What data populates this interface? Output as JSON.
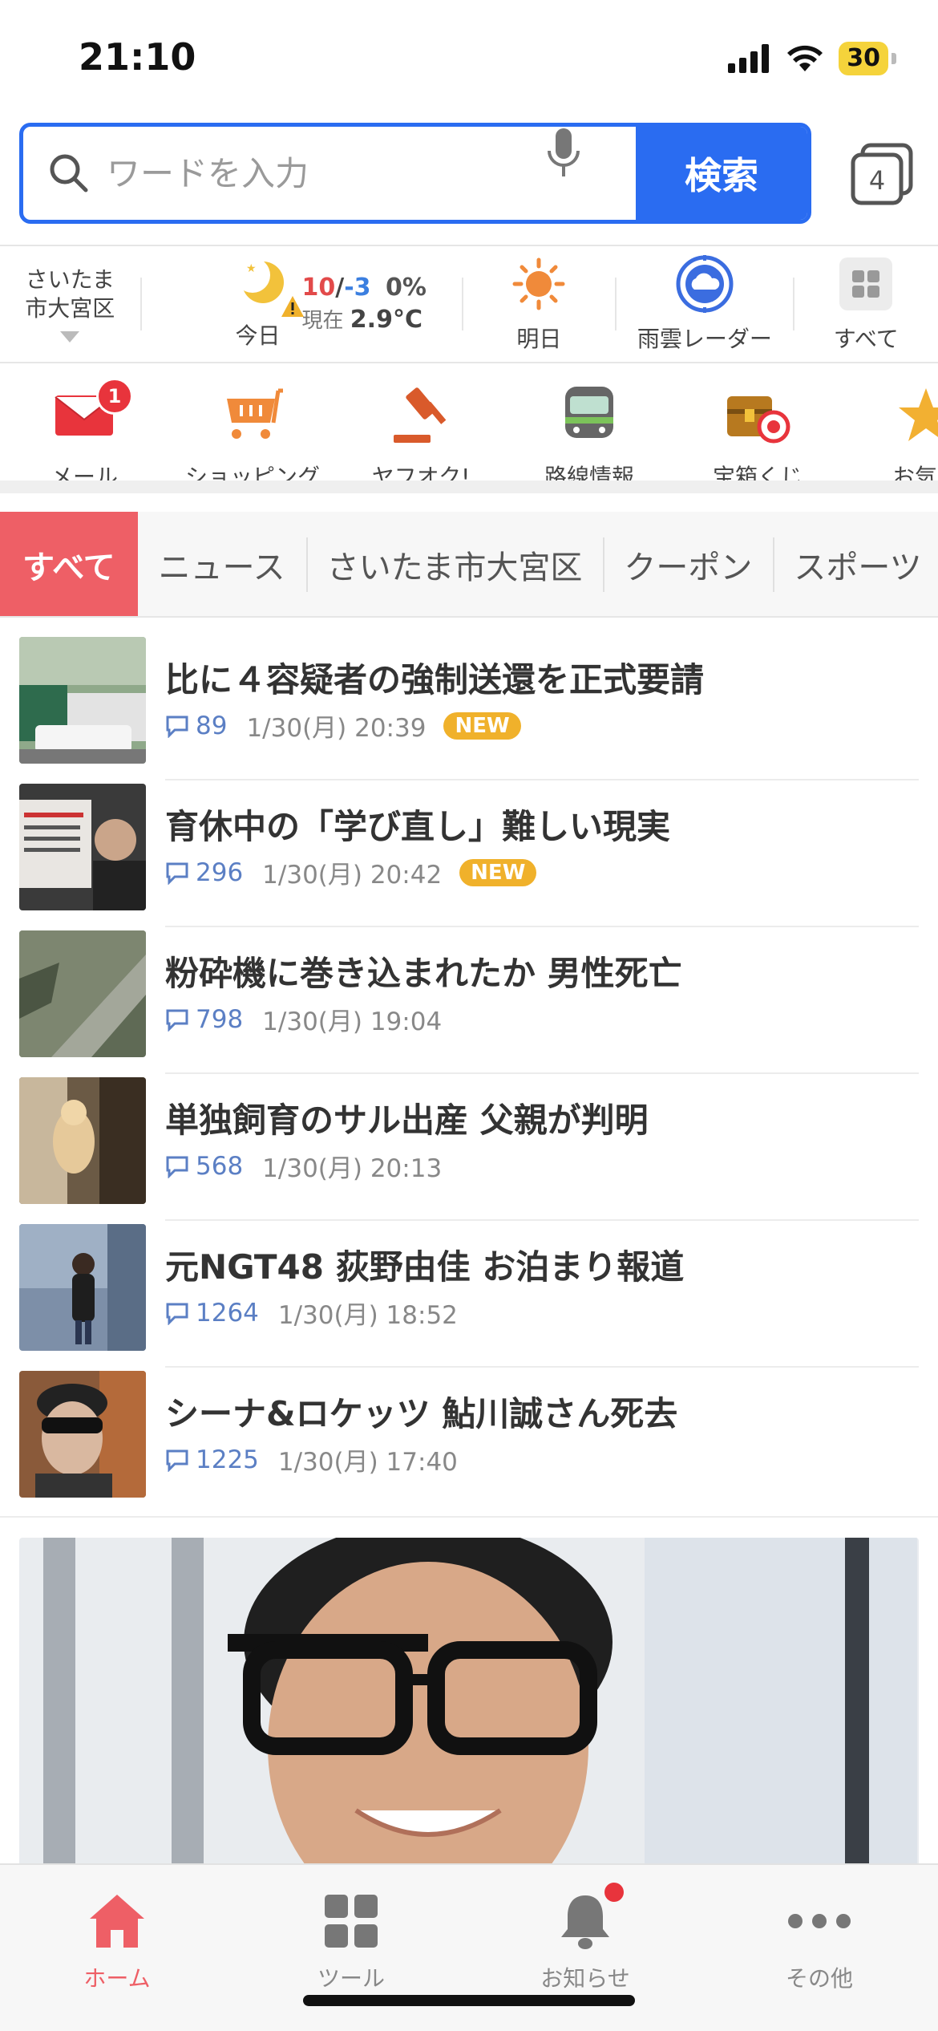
{
  "status_bar": {
    "time": "21:10",
    "battery": "30"
  },
  "search": {
    "placeholder": "ワードを入力",
    "button_label": "検索",
    "tab_count": "4"
  },
  "weather": {
    "location_line1": "さいたま",
    "location_line2": "市大宮区",
    "today_label": "今日",
    "high": "10",
    "low": "-3",
    "precip": "0%",
    "now_prefix": "現在",
    "now_temp": "2.9°C",
    "tomorrow_label": "明日",
    "radar_label": "雨雲レーダー",
    "all_label": "すべて"
  },
  "services": [
    {
      "label": "メール",
      "icon": "mail-icon",
      "badge": "1"
    },
    {
      "label": "ショッピング",
      "icon": "shopping-cart-icon"
    },
    {
      "label": "ヤフオク!",
      "icon": "auction-gavel-icon"
    },
    {
      "label": "路線情報",
      "icon": "train-icon"
    },
    {
      "label": "宝箱くじ",
      "icon": "treasure-box-icon"
    },
    {
      "label": "お気に",
      "icon": "star-icon"
    }
  ],
  "categories": [
    "すべて",
    "ニュース",
    "さいたま市大宮区",
    "クーポン",
    "スポーツ"
  ],
  "news": [
    {
      "title": "比に４容疑者の強制送還を正式要請",
      "comments": "89",
      "time": "1/30(月) 20:39",
      "new": "NEW"
    },
    {
      "title": "育休中の「学び直し」難しい現実",
      "comments": "296",
      "time": "1/30(月) 20:42",
      "new": "NEW"
    },
    {
      "title": "粉砕機に巻き込まれたか 男性死亡",
      "comments": "798",
      "time": "1/30(月) 19:04"
    },
    {
      "title": "単独飼育のサル出産 父親が判明",
      "comments": "568",
      "time": "1/30(月) 20:13"
    },
    {
      "title": "元NGT48 荻野由佳 お泊まり報道",
      "comments": "1264",
      "time": "1/30(月) 18:52"
    },
    {
      "title": "シーナ&ロケッツ 鮎川誠さん死去",
      "comments": "1225",
      "time": "1/30(月) 17:40"
    }
  ],
  "bottom_nav": [
    {
      "label": "ホーム",
      "icon": "home-icon"
    },
    {
      "label": "ツール",
      "icon": "tools-grid-icon"
    },
    {
      "label": "お知らせ",
      "icon": "bell-icon"
    },
    {
      "label": "その他",
      "icon": "more-dots-icon"
    }
  ],
  "colors": {
    "accent_blue": "#2a6cf1",
    "accent_red": "#ee5f66",
    "new_badge": "#f0b12b",
    "comment_blue": "#5b7fc4"
  }
}
